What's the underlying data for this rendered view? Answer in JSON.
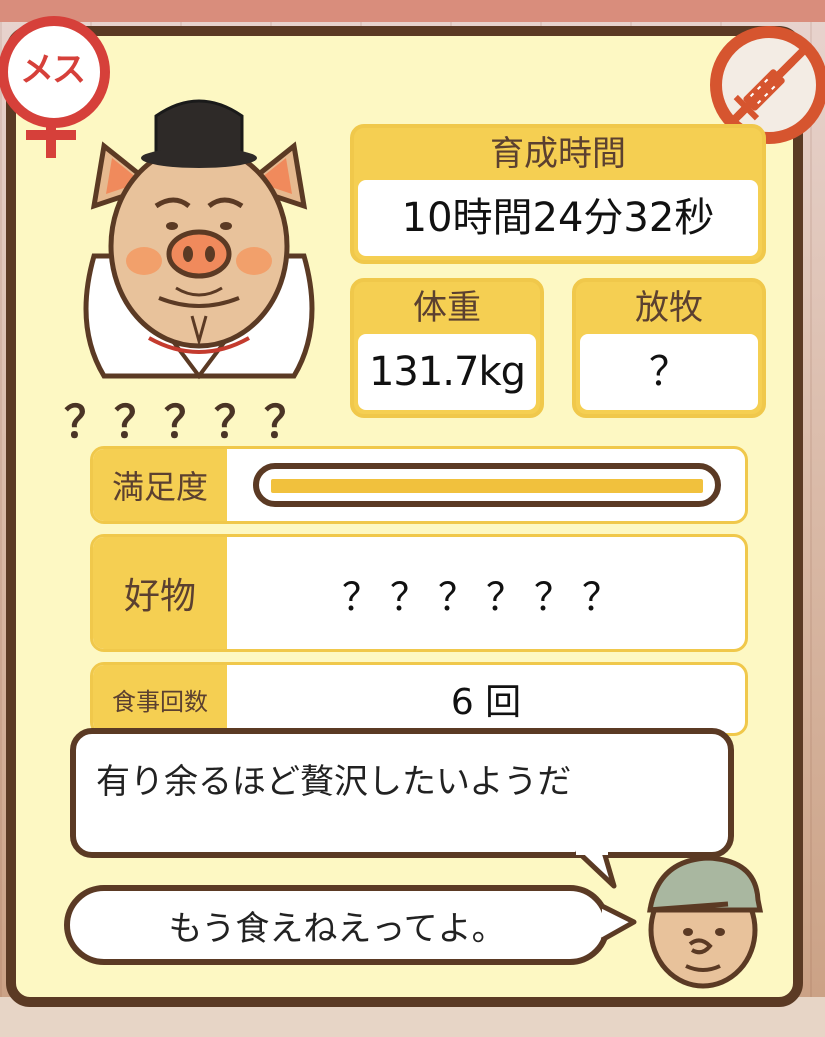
{
  "badges": {
    "gender_label": "メス",
    "gender_icon": "female-symbol-icon",
    "injection_icon": "syringe-prohibited-icon"
  },
  "pig": {
    "name": "？？？？？",
    "icon": "noble-pig-portrait"
  },
  "stats": {
    "time_label": "育成時間",
    "time_value": "10時間24分32秒",
    "weight_label": "体重",
    "weight_value": "131.7kg",
    "pasture_label": "放牧",
    "pasture_value": "？"
  },
  "satisfaction": {
    "label": "満足度",
    "level": 1.0
  },
  "favorite": {
    "label": "好物",
    "value": "？？？？？？"
  },
  "meals": {
    "label": "食事回数",
    "value": "6 回"
  },
  "speech": {
    "pig_thought": "有り余るほど贅沢したいようだ",
    "farmer_line": "もう食えねえってよ。"
  },
  "colors": {
    "panel_bg": "#fdf8c3",
    "frame": "#5b3a24",
    "accent_yellow": "#f5cf52",
    "badge_red": "#d6403a"
  }
}
